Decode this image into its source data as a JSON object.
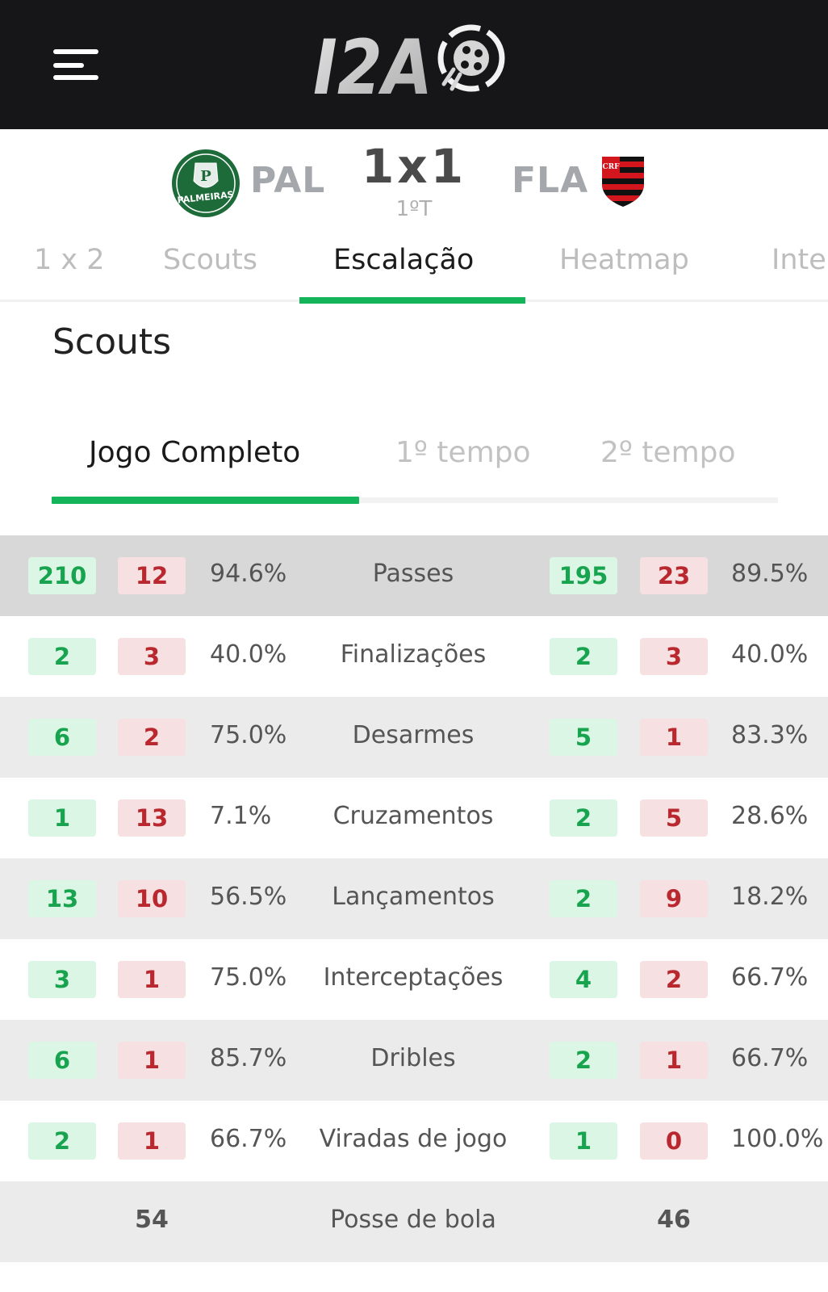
{
  "header": {
    "logo_text": "I2A",
    "menu_icon": "hamburger-menu-icon"
  },
  "match": {
    "home": {
      "abbr": "PAL",
      "crest": "palmeiras-crest",
      "crest_text": "PALMEIRAS",
      "color": "#1e6b3a"
    },
    "away": {
      "abbr": "FLA",
      "crest": "flamengo-crest",
      "crest_text": "CRF",
      "colors": [
        "#d3161e",
        "#111111"
      ]
    },
    "score": "1x1",
    "period": "1ºT"
  },
  "main_tabs": [
    {
      "label": "1 x 2",
      "active": false
    },
    {
      "label": "Scouts",
      "active": false
    },
    {
      "label": "Escalação",
      "active": true
    },
    {
      "label": "Heatmap",
      "active": false
    },
    {
      "label": "Inte",
      "active": false
    }
  ],
  "section": {
    "title": "Scouts"
  },
  "period_tabs": [
    {
      "label": "Jogo Completo",
      "active": true
    },
    {
      "label": "1º tempo",
      "active": false
    },
    {
      "label": "2º tempo",
      "active": false
    }
  ],
  "colors": {
    "accent": "#13b45a",
    "success_bg": "#dcf6e6",
    "success_text": "#18a44e",
    "error_bg": "#f7e0e1",
    "error_text": "#b8282e"
  },
  "stats": [
    {
      "label": "Passes",
      "home": {
        "ok": "210",
        "err": "12",
        "pct": "94.6%"
      },
      "away": {
        "ok": "195",
        "err": "23",
        "pct": "89.5%"
      }
    },
    {
      "label": "Finalizações",
      "home": {
        "ok": "2",
        "err": "3",
        "pct": "40.0%"
      },
      "away": {
        "ok": "2",
        "err": "3",
        "pct": "40.0%"
      }
    },
    {
      "label": "Desarmes",
      "home": {
        "ok": "6",
        "err": "2",
        "pct": "75.0%"
      },
      "away": {
        "ok": "5",
        "err": "1",
        "pct": "83.3%"
      }
    },
    {
      "label": "Cruzamentos",
      "home": {
        "ok": "1",
        "err": "13",
        "pct": "7.1%"
      },
      "away": {
        "ok": "2",
        "err": "5",
        "pct": "28.6%"
      }
    },
    {
      "label": "Lançamentos",
      "home": {
        "ok": "13",
        "err": "10",
        "pct": "56.5%"
      },
      "away": {
        "ok": "2",
        "err": "9",
        "pct": "18.2%"
      }
    },
    {
      "label": "Interceptações",
      "home": {
        "ok": "3",
        "err": "1",
        "pct": "75.0%"
      },
      "away": {
        "ok": "4",
        "err": "2",
        "pct": "66.7%"
      }
    },
    {
      "label": "Dribles",
      "home": {
        "ok": "6",
        "err": "1",
        "pct": "85.7%"
      },
      "away": {
        "ok": "2",
        "err": "1",
        "pct": "66.7%"
      }
    },
    {
      "label": "Viradas de jogo",
      "home": {
        "ok": "2",
        "err": "1",
        "pct": "66.7%"
      },
      "away": {
        "ok": "1",
        "err": "0",
        "pct": "100.0%"
      }
    }
  ],
  "possession": {
    "label": "Posse de bola",
    "home": "54",
    "away": "46"
  }
}
